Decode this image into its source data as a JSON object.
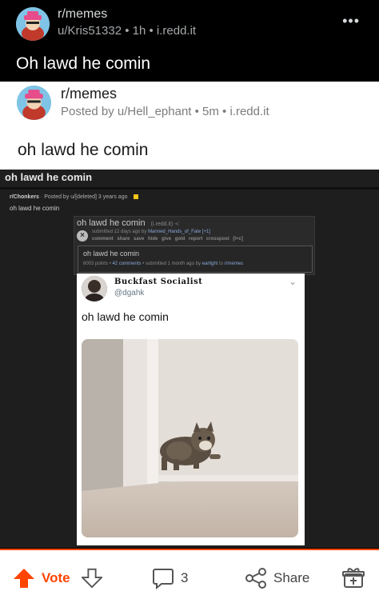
{
  "outer": {
    "subreddit": "r/memes",
    "meta": "u/Kris51332 • 1h • i.redd.it",
    "more": "•••",
    "title": "Oh lawd he comin"
  },
  "light": {
    "subreddit": "r/memes",
    "meta": "Posted by u/Hell_ephant • 5m • i.redd.it",
    "title": "oh lawd he comin"
  },
  "dark_shot": {
    "title": "oh lawd he comin",
    "sub_name": "r/Chonkers",
    "sub_meta": "· Posted by u/[deleted] 3 years ago",
    "subtitle": "oh lawd he comin"
  },
  "old_reddit": {
    "title": "oh lawd he comin",
    "domain": "(i.redd.it) ≺",
    "x": "×",
    "submitted_prefix": "submitted 12 days ago by",
    "submitted_user": "Manned_Hands_of_Fate",
    "submitted_suffix": "[+1]",
    "actions": "comment share save hide give gold report crosspost [l+c]",
    "inner_title": "oh lawd he comin",
    "inner_meta_prefix": "6003 points •",
    "inner_meta_comments": "42 comments",
    "inner_meta_middle": "• submitted 1 month ago by",
    "inner_meta_user": "earlight",
    "inner_meta_to": "to",
    "inner_meta_sub": "r/memes"
  },
  "tweet": {
    "name": "Buckfast Socialist",
    "handle": "@dgahk",
    "chevron": "⌄",
    "text": "oh lawd he comin"
  },
  "actions": {
    "vote": "Vote",
    "comments": "3",
    "share": "Share"
  },
  "colors": {
    "upvote": "#ff4500",
    "link": "#8aa8d8"
  }
}
